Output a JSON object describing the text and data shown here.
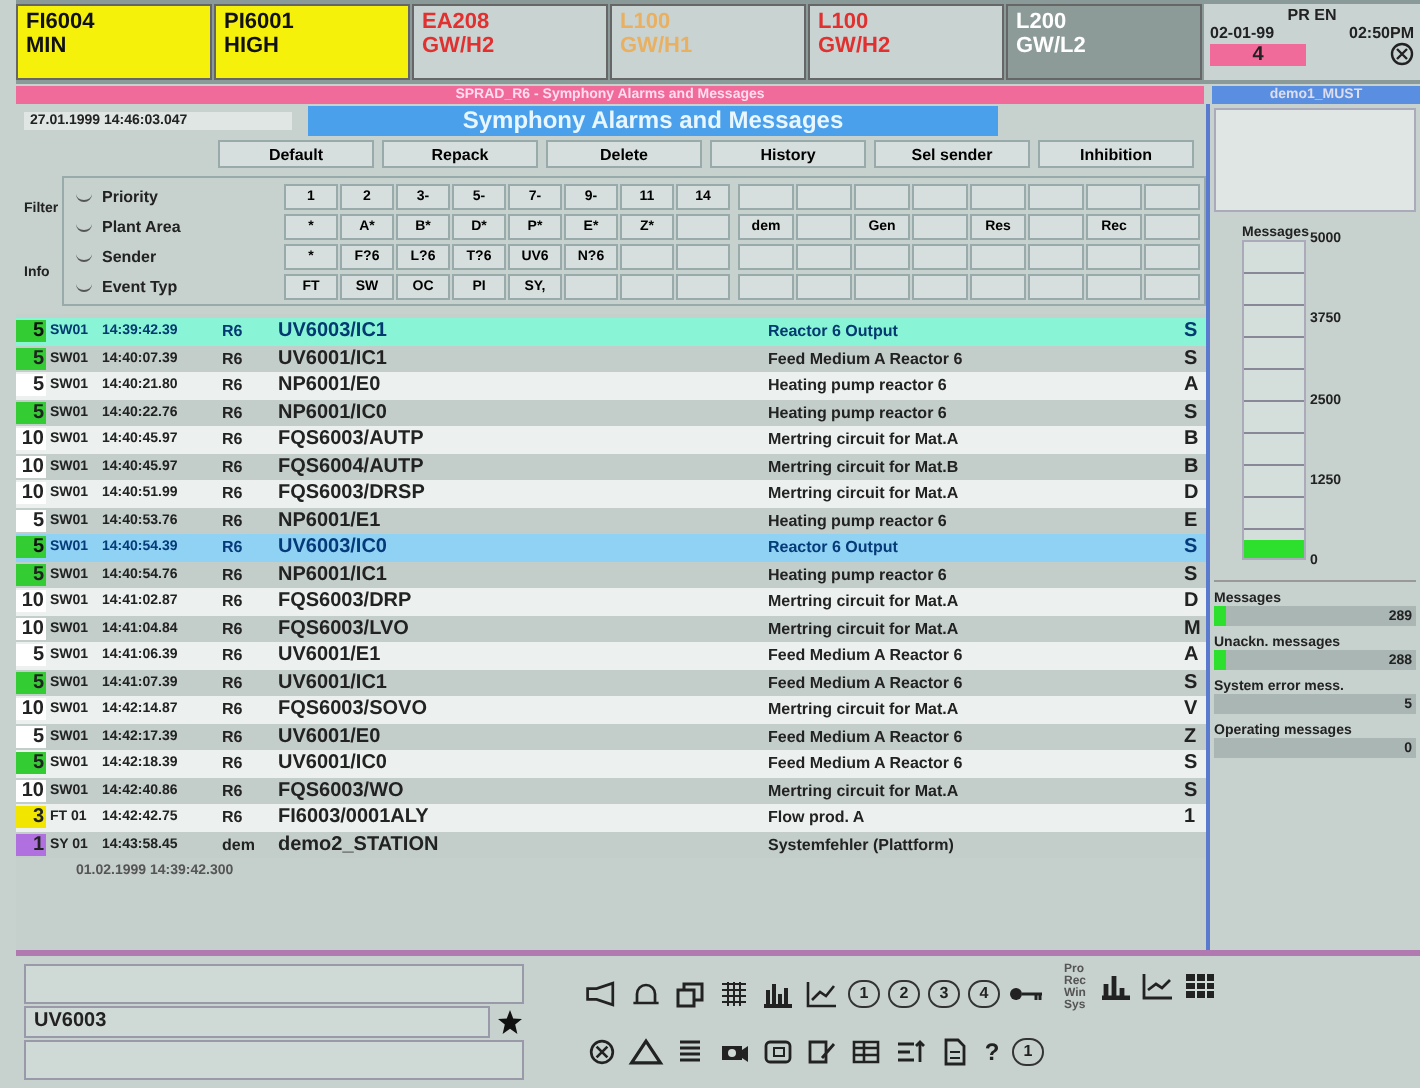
{
  "alarm_tiles": [
    {
      "tag": "FI6004",
      "state": "MIN",
      "kind": "active"
    },
    {
      "tag": "PI6001",
      "state": "HIGH",
      "kind": "active"
    },
    {
      "tag": "EA208",
      "state": "GW/H2",
      "kind": "alarm"
    },
    {
      "tag": "L100",
      "state": "GW/H1",
      "kind": "warning"
    },
    {
      "tag": "L100",
      "state": "GW/H2",
      "kind": "alarm"
    },
    {
      "tag": "L200",
      "state": "GW/L2",
      "kind": "faded"
    }
  ],
  "clock": {
    "header": "PR EN",
    "date": "02-01-99",
    "time": "02:50PM",
    "count": "4"
  },
  "title_bar": "SPRAD_R6 - Symphony Alarms and Messages",
  "side_title": "demo1_MUST",
  "toolbar": {
    "timestamp": "27.01.1999 14:46:03.047",
    "title": "Symphony Alarms and Messages",
    "buttons": [
      "Default",
      "Repack",
      "Delete",
      "History",
      "Sel sender",
      "Inhibition"
    ]
  },
  "filter": {
    "labels": [
      "Filter",
      "Info"
    ],
    "rows": [
      {
        "label": "Priority",
        "selected": false,
        "cells": [
          "1",
          "2",
          "3-",
          "5-",
          "7-",
          "9-",
          "11",
          "14"
        ],
        "extra": []
      },
      {
        "label": "Plant Area",
        "selected": false,
        "cells": [
          "*",
          "A*",
          "B*",
          "D*",
          "P*",
          "E*",
          "Z*"
        ],
        "extra": [
          "dem",
          "Gen",
          "Res",
          "Rec"
        ]
      },
      {
        "label": "Sender",
        "selected": false,
        "cells": [
          "*",
          "F?6",
          "L?6",
          "T?6",
          "UV6",
          "N?6"
        ],
        "extra": []
      },
      {
        "label": "Event Typ",
        "selected": false,
        "cells": [
          "FT",
          "SW",
          "OC",
          "PI",
          "SY,"
        ],
        "extra": []
      }
    ]
  },
  "table": {
    "rows": [
      {
        "prio": "5",
        "color": "#33cc33",
        "event": "SW01",
        "time": "14:39:42.39",
        "area": "R6",
        "tag": "UV6003/IC1",
        "text": "Reactor 6 Output",
        "col": "S",
        "active": true,
        "selected": false
      },
      {
        "prio": "5",
        "color": "#33cc33",
        "event": "SW01",
        "time": "14:40:07.39",
        "area": "R6",
        "tag": "UV6001/IC1",
        "text": "Feed Medium A Reactor 6",
        "col": "S",
        "active": false,
        "selected": false
      },
      {
        "prio": "5",
        "color": "#ffffff",
        "event": "SW01",
        "time": "14:40:21.80",
        "area": "R6",
        "tag": "NP6001/E0",
        "text": "Heating pump reactor 6",
        "col": "A",
        "active": false,
        "selected": false
      },
      {
        "prio": "5",
        "color": "#33cc33",
        "event": "SW01",
        "time": "14:40:22.76",
        "area": "R6",
        "tag": "NP6001/IC0",
        "text": "Heating pump reactor 6",
        "col": "S",
        "active": false,
        "selected": false
      },
      {
        "prio": "10",
        "color": "#ffffff",
        "event": "SW01",
        "time": "14:40:45.97",
        "area": "R6",
        "tag": "FQS6003/AUTP",
        "text": "Mertring circuit for Mat.A",
        "col": "B",
        "active": false,
        "selected": false
      },
      {
        "prio": "10",
        "color": "#ffffff",
        "event": "SW01",
        "time": "14:40:45.97",
        "area": "R6",
        "tag": "FQS6004/AUTP",
        "text": "Mertring circuit for Mat.B",
        "col": "B",
        "active": false,
        "selected": false
      },
      {
        "prio": "10",
        "color": "#ffffff",
        "event": "SW01",
        "time": "14:40:51.99",
        "area": "R6",
        "tag": "FQS6003/DRSP",
        "text": "Mertring circuit for Mat.A",
        "col": "D",
        "active": false,
        "selected": false
      },
      {
        "prio": "5",
        "color": "#ffffff",
        "event": "SW01",
        "time": "14:40:53.76",
        "area": "R6",
        "tag": "NP6001/E1",
        "text": "Heating pump reactor 6",
        "col": "E",
        "active": false,
        "selected": false
      },
      {
        "prio": "5",
        "color": "#33cc33",
        "event": "SW01",
        "time": "14:40:54.39",
        "area": "R6",
        "tag": "UV6003/IC0",
        "text": "Reactor 6 Output",
        "col": "S",
        "active": false,
        "selected": true
      },
      {
        "prio": "5",
        "color": "#33cc33",
        "event": "SW01",
        "time": "14:40:54.76",
        "area": "R6",
        "tag": "NP6001/IC1",
        "text": "Heating pump reactor 6",
        "col": "S",
        "active": false,
        "selected": false
      },
      {
        "prio": "10",
        "color": "#ffffff",
        "event": "SW01",
        "time": "14:41:02.87",
        "area": "R6",
        "tag": "FQS6003/DRP",
        "text": "Mertring circuit for Mat.A",
        "col": "D",
        "active": false,
        "selected": false
      },
      {
        "prio": "10",
        "color": "#ffffff",
        "event": "SW01",
        "time": "14:41:04.84",
        "area": "R6",
        "tag": "FQS6003/LVO",
        "text": "Mertring circuit for Mat.A",
        "col": "M",
        "active": false,
        "selected": false
      },
      {
        "prio": "5",
        "color": "#ffffff",
        "event": "SW01",
        "time": "14:41:06.39",
        "area": "R6",
        "tag": "UV6001/E1",
        "text": "Feed Medium A Reactor 6",
        "col": "A",
        "active": false,
        "selected": false
      },
      {
        "prio": "5",
        "color": "#33cc33",
        "event": "SW01",
        "time": "14:41:07.39",
        "area": "R6",
        "tag": "UV6001/IC1",
        "text": "Feed Medium A Reactor 6",
        "col": "S",
        "active": false,
        "selected": false
      },
      {
        "prio": "10",
        "color": "#ffffff",
        "event": "SW01",
        "time": "14:42:14.87",
        "area": "R6",
        "tag": "FQS6003/SOVO",
        "text": "Mertring circuit for Mat.A",
        "col": "V",
        "active": false,
        "selected": false
      },
      {
        "prio": "5",
        "color": "#ffffff",
        "event": "SW01",
        "time": "14:42:17.39",
        "area": "R6",
        "tag": "UV6001/E0",
        "text": "Feed Medium A Reactor 6",
        "col": "Z",
        "active": false,
        "selected": false
      },
      {
        "prio": "5",
        "color": "#33cc33",
        "event": "SW01",
        "time": "14:42:18.39",
        "area": "R6",
        "tag": "UV6001/IC0",
        "text": "Feed Medium A Reactor 6",
        "col": "S",
        "active": false,
        "selected": false
      },
      {
        "prio": "10",
        "color": "#ffffff",
        "event": "SW01",
        "time": "14:42:40.86",
        "area": "R6",
        "tag": "FQS6003/WO",
        "text": "Mertring circuit for Mat.A",
        "col": "S",
        "active": false,
        "selected": false
      },
      {
        "prio": "3",
        "color": "#f2e600",
        "event": "FT 01",
        "time": "14:42:42.75",
        "area": "R6",
        "tag": "FI6003/0001ALY",
        "text": "Flow prod. A",
        "col": "1",
        "active": false,
        "selected": false
      },
      {
        "prio": "1",
        "color": "#b070e0",
        "event": "SY 01",
        "time": "14:43:58.45",
        "area": "dem",
        "tag": "demo2_STATION",
        "text": "Systemfehler (Plattform)",
        "active": false,
        "selected": false
      }
    ],
    "footer": "01.02.1999  14:39:42.300"
  },
  "gauge": {
    "title": "Messages",
    "ticks": [
      "5000",
      "3750",
      "2500",
      "1250",
      "0"
    ],
    "level": 0.06
  },
  "counters": [
    {
      "label": "Messages",
      "value": "289",
      "level": 0.06
    },
    {
      "label": "Unackn. messages",
      "value": "288",
      "level": 0.06
    },
    {
      "label": "System error mess.",
      "value": "5"
    },
    {
      "label": "Operating messages",
      "value": "0"
    }
  ],
  "command": {
    "value": "UV6003"
  },
  "number_buttons": [
    "1",
    "2",
    "3",
    "4"
  ],
  "help_button": "?",
  "single_button": "1",
  "mode_labels": [
    "Pro",
    "Rec",
    "Win",
    "Sys"
  ]
}
